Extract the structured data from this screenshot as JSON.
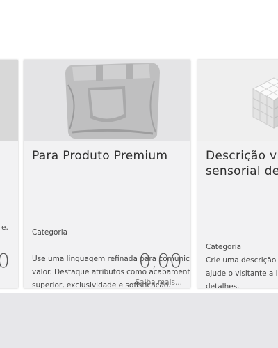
{
  "cards": [
    {
      "title": "",
      "category": "",
      "description": "e.",
      "price": "0"
    },
    {
      "title": "Para Produto Premium",
      "category": "Categoria",
      "description": "Use uma linguagem refinada para comunicar valor. Destaque atributos como acabamento superior, exclusividade e sofisticação.",
      "price": "0,00",
      "more_label": "Saiba mais..."
    },
    {
      "title": "Descrição visual sensorial detalhada",
      "title_lines": [
        "Descrição vis",
        "sensorial deta"
      ],
      "category": "Categoria",
      "description_lines": [
        "Crie uma descrição s",
        "ajude o visitante a in",
        "detalhes."
      ]
    }
  ]
}
